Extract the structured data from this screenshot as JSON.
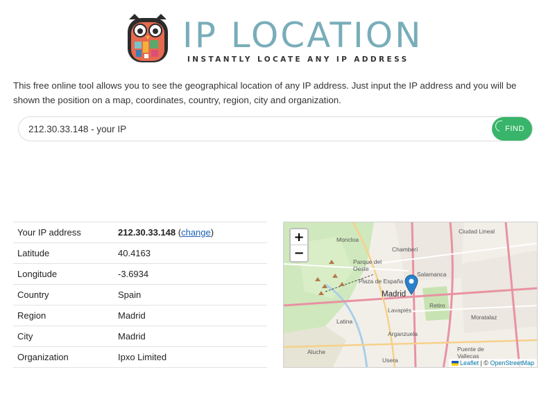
{
  "header": {
    "title": "IP LOCATION",
    "subtitle": "INSTANTLY LOCATE ANY IP ADDRESS",
    "logo_icon": "owl-logo-icon"
  },
  "intro": "This free online tool allows you to see the geographical location of any IP address. Just input the IP address and you will be shown the position on a map, coordinates, country, region, city and organization.",
  "search": {
    "value": "212.30.33.148 - your IP",
    "button_label": "FIND",
    "button_color": "#38b56a"
  },
  "info": {
    "rows": [
      {
        "label": "Your IP address",
        "value": "212.30.33.148",
        "link": "change"
      },
      {
        "label": "Latitude",
        "value": "40.4163"
      },
      {
        "label": "Longitude",
        "value": "-3.6934"
      },
      {
        "label": "Country",
        "value": "Spain"
      },
      {
        "label": "Region",
        "value": "Madrid"
      },
      {
        "label": "City",
        "value": "Madrid"
      },
      {
        "label": "Organization",
        "value": "Ipxo Limited"
      }
    ]
  },
  "map": {
    "zoom_in": "+",
    "zoom_out": "−",
    "city_label": "Madrid",
    "labels": {
      "moncloa": "Moncloa",
      "chamberi": "Chamberí",
      "ciudad_lineal": "Ciudad Lineal",
      "parque_oeste": "Parque del Oeste",
      "salamanca": "Salamanca",
      "plaza_espana": "Plaza de España",
      "retiro": "Retiro",
      "lavapies": "Lavapiés",
      "latina": "Latina",
      "moratalaz": "Moratalaz",
      "arganzuela": "Arganzuela",
      "usera": "Usera",
      "aluche": "Aluche",
      "puente_vallecas": "Puente de Vallecas"
    },
    "attribution_leaflet": "Leaflet",
    "attribution_sep": " | © ",
    "attribution_osm": "OpenStreetMap",
    "marker_color": "#2a81cb"
  }
}
